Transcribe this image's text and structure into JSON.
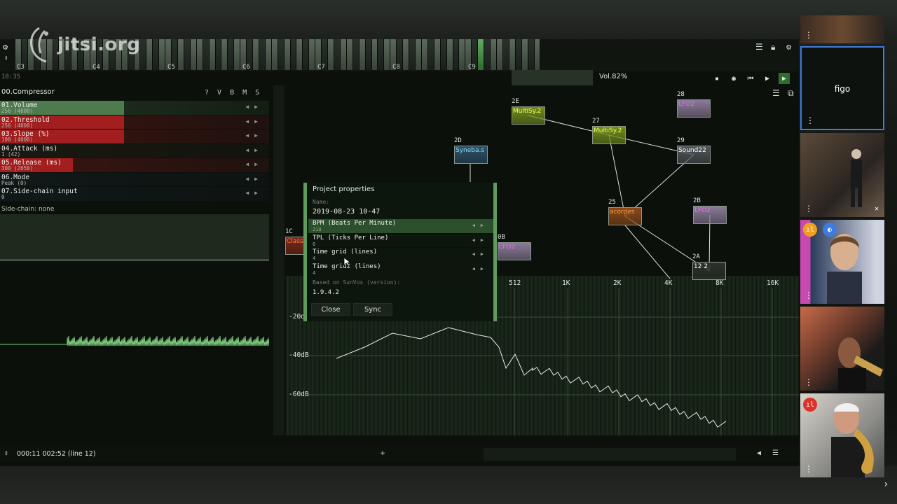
{
  "jitsi": {
    "logo_text": "jitsi.org"
  },
  "piano": {
    "octaves": [
      "C3",
      "C4",
      "C5",
      "C6",
      "C7",
      "C8",
      "C9"
    ],
    "clock": "18:35",
    "volume": "Vol.82%"
  },
  "compressor": {
    "title": "00.Compressor",
    "buttons": [
      "?",
      "V",
      "B",
      "M",
      "S"
    ],
    "params": [
      {
        "name": "01.Volume",
        "value": "256 (4000)",
        "color": "#4e7b4e",
        "fill": 0.46
      },
      {
        "name": "02.Threshold",
        "value": "256 (4000)",
        "color": "#a31e1e",
        "fill": 0.46
      },
      {
        "name": "03.Slope (%)",
        "value": "100 (4000)",
        "color": "#a31e1e",
        "fill": 0.46
      },
      {
        "name": "04.Attack (ms)",
        "value": "1 (42)",
        "color": "#3a2a1a",
        "fill": 0.0
      },
      {
        "name": "05.Release (ms)",
        "value": "300 (2650)",
        "color": "#a31e1e",
        "fill": 0.27
      },
      {
        "name": "06.Mode",
        "value": "Peak (0)",
        "color": "#1a2a36",
        "fill": 0.0
      },
      {
        "name": "07.Side-chain input",
        "value": "0",
        "color": "#1a2a36",
        "fill": 0.0
      }
    ],
    "sidechain": "Side-chain: none"
  },
  "modules": [
    {
      "num": "2E",
      "name": "MultiSy.2",
      "color": "#6f8b1e",
      "text": "#f2ff5a"
    },
    {
      "num": "27",
      "name": "MultiSy.2",
      "color": "#6f8b1e",
      "text": "#f2ff5a"
    },
    {
      "num": "28",
      "name": "LFO2",
      "color": "#8a7a9a",
      "text": "#e070e0"
    },
    {
      "num": "2D",
      "name": "Syneba.s",
      "color": "#2e5268",
      "text": "#86dcff"
    },
    {
      "num": "29",
      "name": "Sound22",
      "color": "#50565a",
      "text": "#ffffff"
    },
    {
      "num": "25",
      "name": "acordes",
      "color": "#8a4a1a",
      "text": "#ff9b3c"
    },
    {
      "num": "2B",
      "name": "LFO2",
      "color": "#8a7a9a",
      "text": "#e070e0"
    },
    {
      "num": "0B",
      "name": "LFO2",
      "color": "#8a7a9a",
      "text": "#e070e0"
    },
    {
      "num": "2A",
      "name": "12 2",
      "color": "#2c322c",
      "text": "#ffffff"
    },
    {
      "num": "1C",
      "name": "Class",
      "color": "#7a2a1a",
      "text": "#ff7a3c"
    }
  ],
  "spectrum": {
    "freq_labels": [
      "512",
      "1K",
      "2K",
      "4K",
      "8K",
      "16K"
    ],
    "db_labels": [
      "-20dB",
      "-40dB",
      "-60dB"
    ]
  },
  "dialog": {
    "title": "Project properties",
    "name_label": "Name:",
    "name_value": "2019-08-23 10-47",
    "rows": [
      {
        "name": "BPM (Beats Per Minute)",
        "value": "210"
      },
      {
        "name": "TPL (Ticks Per Line)",
        "value": "6"
      },
      {
        "name": "Time grid (lines)",
        "value": "4"
      },
      {
        "name": "Time grid2 (lines)",
        "value": "4"
      }
    ],
    "based_label": "Based on SunVox (version):",
    "based_value": "1.9.4.2",
    "close_label": "Close",
    "sync_label": "Sync"
  },
  "bottom": {
    "time": "000:11  002:52 (line 12)"
  },
  "participants": [
    {
      "name": ""
    },
    {
      "name": "figo"
    },
    {
      "name": ""
    },
    {
      "name": ""
    },
    {
      "name": ""
    },
    {
      "name": ""
    }
  ]
}
